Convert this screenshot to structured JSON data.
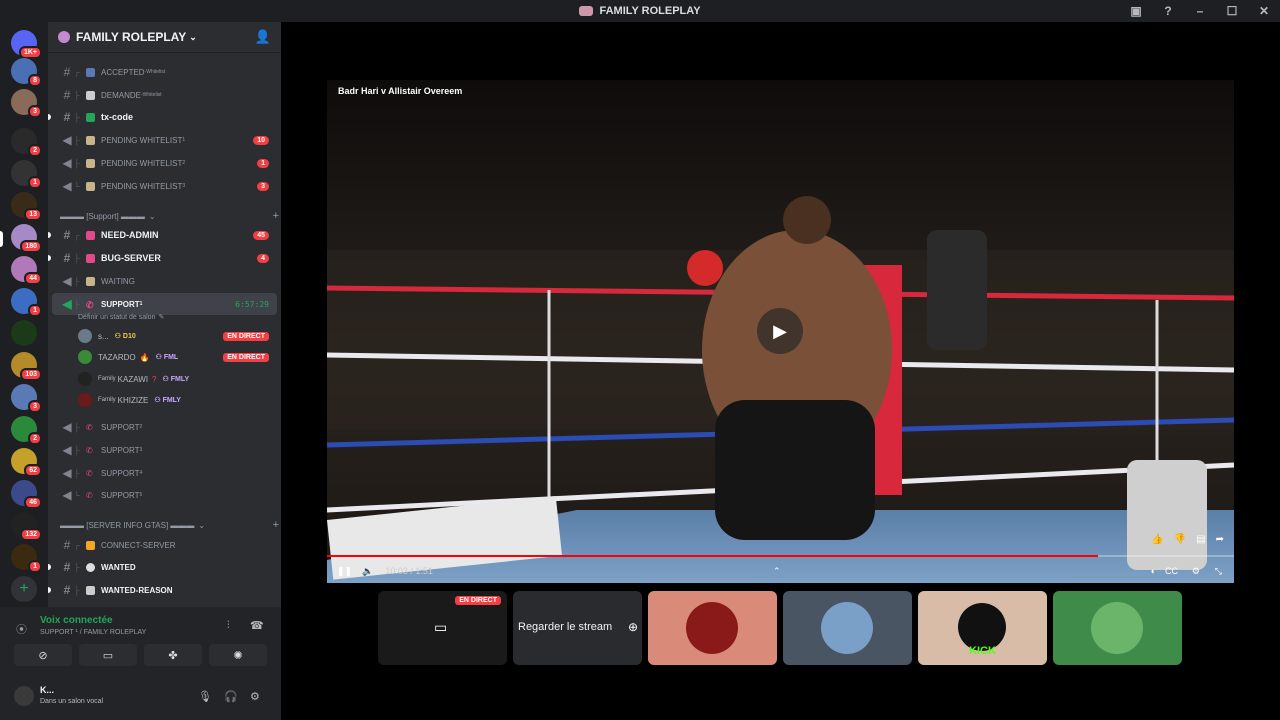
{
  "window": {
    "title": "FAMILY ROLEPLAY"
  },
  "guilds": [
    {
      "badge": "1K+"
    },
    {
      "badge": "8"
    },
    {
      "badge": "3"
    },
    {
      "badge": "2"
    },
    {
      "badge": "1"
    },
    {
      "badge": "13"
    },
    {
      "badge": "180"
    },
    {
      "badge": "44"
    },
    {
      "badge": "1"
    },
    {
      "badge": ""
    },
    {
      "badge": "103"
    },
    {
      "badge": "3"
    },
    {
      "badge": "2"
    },
    {
      "badge": "62"
    },
    {
      "badge": "46"
    },
    {
      "badge": "132"
    },
    {
      "badge": "1"
    }
  ],
  "server": {
    "name": "FAMILY ROLEPLAY"
  },
  "channels": {
    "accepted": {
      "name": "ACCEPTED",
      "sup": "-Whitelist"
    },
    "demande": {
      "name": "DEMANDE",
      "sup": "-Whitelist"
    },
    "txcode": {
      "name": "tx-code"
    },
    "pending1": {
      "name": "PENDING WHITELIST",
      "sup": "1",
      "count": "10"
    },
    "pending2": {
      "name": "PENDING WHITELIST",
      "sup": "2",
      "count": "1"
    },
    "pending3": {
      "name": "PENDING WHITELIST",
      "sup": "3",
      "count": "3"
    },
    "cat_support": "▬▬▬ [Support] ▬▬▬",
    "needadmin": {
      "name": "NEED-ADMIN",
      "count": "45"
    },
    "bugserver": {
      "name": "BUG-SERVER",
      "count": "4"
    },
    "waiting": {
      "name": "WAITING"
    },
    "support1": {
      "name": "SUPPORT",
      "sup": "1",
      "timer": "6:57:29",
      "status": "Définir un statut de salon"
    },
    "support2": {
      "name": "SUPPORT",
      "sup": "2"
    },
    "support3": {
      "name": "SUPPORT",
      "sup": "3"
    },
    "support4": {
      "name": "SUPPORT",
      "sup": "4"
    },
    "support5": {
      "name": "SUPPORT",
      "sup": "5"
    },
    "cat_info": "▬▬▬ [SERVER INFO GTAS] ▬▬▬",
    "connect": {
      "name": "CONNECT-SERVER"
    },
    "wanted": {
      "name": "WANTED"
    },
    "wantedreason": {
      "name": "WANTED-REASON"
    }
  },
  "voice_users": [
    {
      "name": "s...",
      "tag": "D10",
      "live": "EN DIRECT"
    },
    {
      "name": "TAZARDO",
      "tag": "FML",
      "live": "EN DIRECT"
    },
    {
      "name": "KAZAWI",
      "tag": "FMLY",
      "prefix": "Family",
      "live": ""
    },
    {
      "name": "KHIZIZE",
      "tag": "FMLY",
      "prefix": "Family",
      "live": ""
    }
  ],
  "voicepanel": {
    "status": "Voix connectée",
    "sub": "SUPPORT ¹ / FAMILY ROLEPLAY",
    "username": "K...",
    "userstatus": "Dans un salon vocal"
  },
  "video": {
    "title": "Badr Hari v Allistair Overeem",
    "time": "10:03 / 1:51",
    "progress": 0.85
  },
  "tiles": {
    "live": "EN DIRECT",
    "watch": "Regarder le stream",
    "kick": "KICK"
  },
  "colors": {
    "accent_red": "#f23f43",
    "voice_green": "#23a55a",
    "tile_salmon": "#d98a79",
    "tile_slate": "#4a5564",
    "tile_beige": "#d9bca7",
    "tile_green": "#3f8b4a"
  }
}
